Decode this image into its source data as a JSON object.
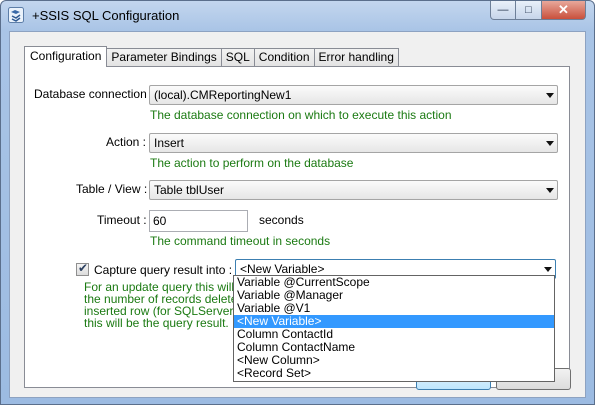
{
  "window": {
    "title": "+SSIS SQL Configuration",
    "icon": "ssis-app-icon",
    "controls": {
      "minimize": "—",
      "maximize": "□",
      "close": "✕"
    }
  },
  "tabs": [
    {
      "label": "Configuration",
      "active": true
    },
    {
      "label": "Parameter Bindings",
      "active": false
    },
    {
      "label": "SQL",
      "active": false
    },
    {
      "label": "Condition",
      "active": false
    },
    {
      "label": "Error handling",
      "active": false
    }
  ],
  "form": {
    "database_connection": {
      "label": "Database connection :",
      "value": "(local).CMReportingNew1",
      "help": "The database connection on which to execute this action"
    },
    "action": {
      "label": "Action :",
      "value": "Insert",
      "help": "The action to perform on the database"
    },
    "table_view": {
      "label": "Table / View :",
      "value": "Table tblUser"
    },
    "timeout": {
      "label": "Timeout :",
      "value": "60",
      "unit": "seconds",
      "help": "The command timeout in seconds"
    },
    "capture": {
      "label": "Capture query result into :",
      "checked": true,
      "value": "<New Variable>",
      "help_lines": [
        "For an update query this will be",
        "the number of records deleted.",
        "inserted row (for SQLServer / M",
        "this will be the query result."
      ]
    }
  },
  "dropdown": {
    "options": [
      "Variable @CurrentScope",
      "Variable @Manager",
      "Variable @V1",
      "<New Variable>",
      "Column ContactId",
      "Column ContactName",
      "<New Column>",
      "<Record Set>"
    ],
    "selected_index": 3
  },
  "colors": {
    "help_text": "#1b7a12",
    "selection": "#3399ff",
    "title_bar": "#a9c4e6"
  }
}
